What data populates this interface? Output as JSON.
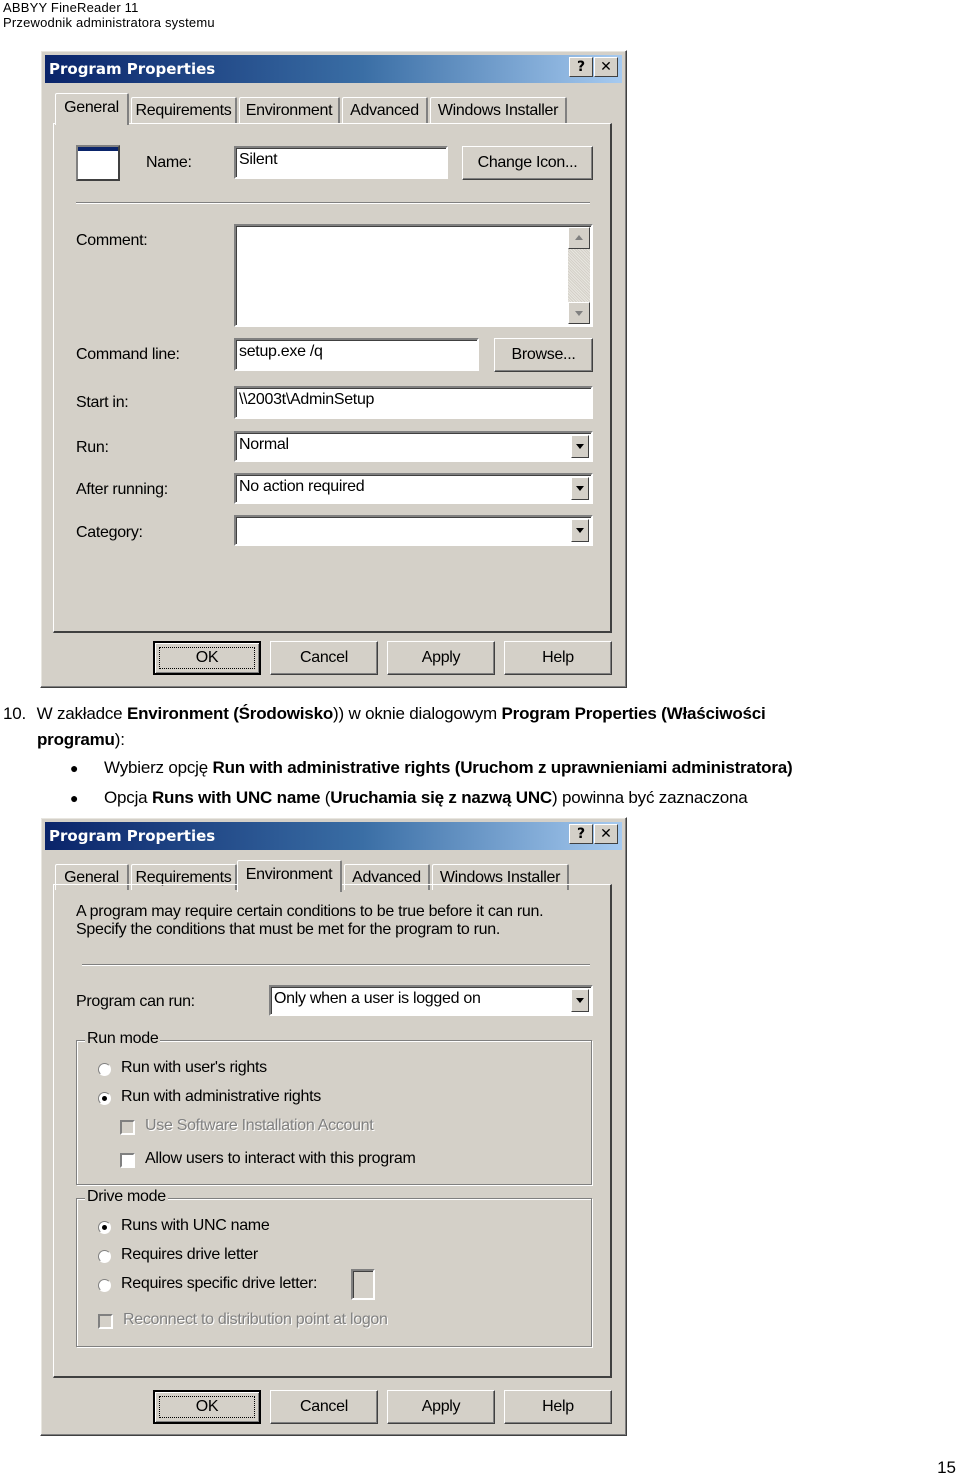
{
  "page_header": {
    "line1": "ABBYY FineReader 11",
    "line2": "Przewodnik administratora systemu"
  },
  "page_number": "15",
  "dialog1": {
    "title": "Program Properties",
    "help_button": "?",
    "close_button": "✕",
    "tabs": [
      "General",
      "Requirements",
      "Environment",
      "Advanced",
      "Windows Installer"
    ],
    "active_tab": "General",
    "name_label": "Name:",
    "name_value": "Silent",
    "change_icon_button": "Change Icon...",
    "comment_label": "Comment:",
    "comment_value": "",
    "command_line_label": "Command line:",
    "command_line_value": "setup.exe /q",
    "browse_button": "Browse...",
    "start_in_label": "Start in:",
    "start_in_value": "\\\\2003t\\AdminSetup",
    "run_label": "Run:",
    "run_value": "Normal",
    "after_running_label": "After running:",
    "after_running_value": "No action required",
    "category_label": "Category:",
    "category_value": "",
    "buttons": {
      "ok": "OK",
      "cancel": "Cancel",
      "apply": "Apply",
      "help": "Help"
    }
  },
  "instructions": {
    "number": "10.",
    "p1_a": "W zakładce ",
    "p1_b": "Environment",
    "p1_c": " (",
    "p1_d": "Środowisko",
    "p1_e": ") w oknie dialogowym ",
    "p1_f": "Program Properties",
    "p1_g": " (",
    "p1_h": "Właściwości",
    "p1_i": "programu",
    "p1_j": "):",
    "bullet1_a": "Wybierz opcję ",
    "bullet1_b": "Run with administrative rights",
    "bullet1_c": " (",
    "bullet1_d": "Uruchom z uprawnieniami administratora",
    "bullet1_e": ")",
    "bullet2_a": "Opcja ",
    "bullet2_b": "Runs with UNC name",
    "bullet2_c": " (",
    "bullet2_d": "Uruchamia się z nazwą UNC",
    "bullet2_e": ") powinna być zaznaczona"
  },
  "dialog2": {
    "title": "Program Properties",
    "help_button": "?",
    "close_button": "✕",
    "tabs": [
      "General",
      "Requirements",
      "Environment",
      "Advanced",
      "Windows Installer"
    ],
    "active_tab": "Environment",
    "description_line1": "A program may require certain conditions to be true before it can run.",
    "description_line2": "Specify the conditions that must be met for the program to run.",
    "program_can_run_label": "Program can run:",
    "program_can_run_value": "Only when a user is logged on",
    "run_mode": {
      "legend": "Run mode",
      "options": [
        {
          "label": "Run with user's rights",
          "checked": false
        },
        {
          "label": "Run with administrative rights",
          "checked": true
        }
      ],
      "use_software_installation_account": {
        "label": "Use Software Installation Account",
        "checked": false,
        "disabled": true
      },
      "allow_interact": {
        "label": "Allow users to interact with this program",
        "checked": false,
        "disabled": false
      }
    },
    "drive_mode": {
      "legend": "Drive mode",
      "options": [
        {
          "label": "Runs with UNC name",
          "checked": true
        },
        {
          "label": "Requires drive letter",
          "checked": false
        },
        {
          "label": "Requires specific drive letter:",
          "checked": false
        }
      ],
      "drive_letter_value": "",
      "reconnect": {
        "label": "Reconnect to distribution point at logon",
        "checked": false,
        "disabled": true
      }
    },
    "buttons": {
      "ok": "OK",
      "cancel": "Cancel",
      "apply": "Apply",
      "help": "Help"
    }
  }
}
